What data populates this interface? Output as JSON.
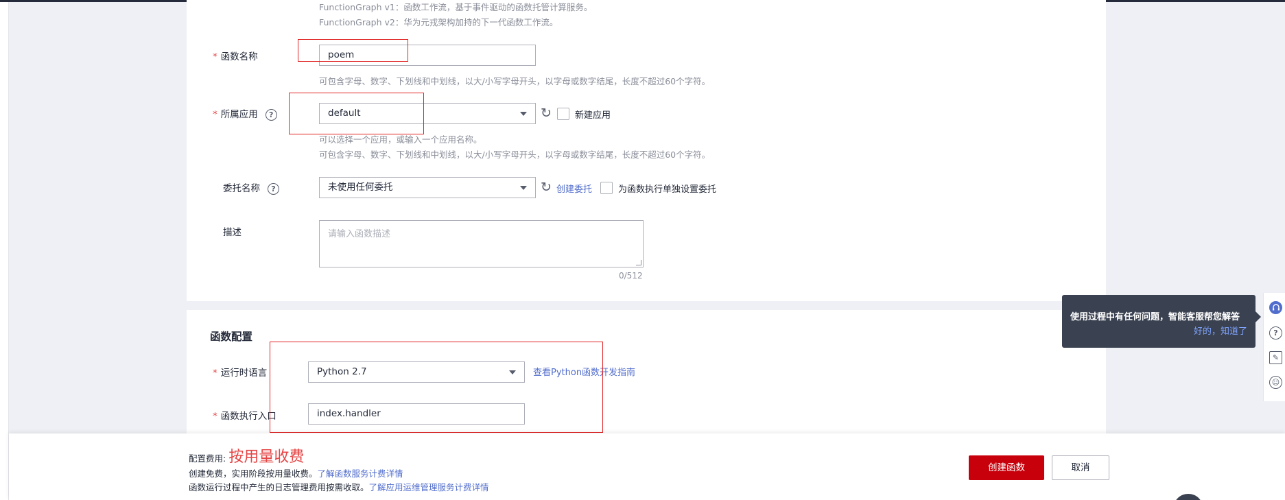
{
  "form": {
    "version_hint_v1": "FunctionGraph v1：函数工作流，基于事件驱动的函数托管计算服务。",
    "version_hint_v2": "FunctionGraph v2：华为元戎架构加持的下一代函数工作流。",
    "function_name": {
      "label": "函数名称",
      "value": "poem",
      "hint": "可包含字母、数字、下划线和中划线，以大/小写字母开头，以字母或数字结尾，长度不超过60个字符。"
    },
    "app": {
      "label": "所属应用",
      "value": "default",
      "new_app_label": "新建应用",
      "hint1": "可以选择一个应用，或输入一个应用名称。",
      "hint2": "可包含字母、数字、下划线和中划线，以大/小写字母开头，以字母或数字结尾，长度不超过60个字符。"
    },
    "agency": {
      "label": "委托名称",
      "value": "未使用任何委托",
      "create_link": "创建委托",
      "separate_label": "为函数执行单独设置委托"
    },
    "description": {
      "label": "描述",
      "placeholder": "请输入函数描述",
      "counter": "0/512"
    }
  },
  "config": {
    "title": "函数配置",
    "runtime": {
      "label": "运行时语言",
      "value": "Python 2.7",
      "guide_link": "查看Python函数开发指南"
    },
    "handler": {
      "label": "函数执行入口",
      "value": "index.handler"
    }
  },
  "tooltip": {
    "text": "使用过程中有任何问题，智能客服帮您解答",
    "ack": "好的，知道了"
  },
  "siderail": {
    "icons": [
      "headset-icon",
      "help-icon",
      "feedback-icon",
      "smile-icon"
    ]
  },
  "footer": {
    "fee_label": "配置费用:",
    "fee_value": "按用量收费",
    "line1_text": "创建免费，实用阶段按用量收费。",
    "line1_link": "了解函数服务计费详情",
    "line2_text": "函数运行过程中产生的日志管理费用按需收取。",
    "line2_link": "了解应用运维管理服务计费详情",
    "create_button": "创建函数",
    "cancel_button": "取消"
  },
  "colors": {
    "accent": "#526ecc",
    "primary_button": "#c7000b",
    "required": "#e54545",
    "highlight_box": "#e02020"
  }
}
